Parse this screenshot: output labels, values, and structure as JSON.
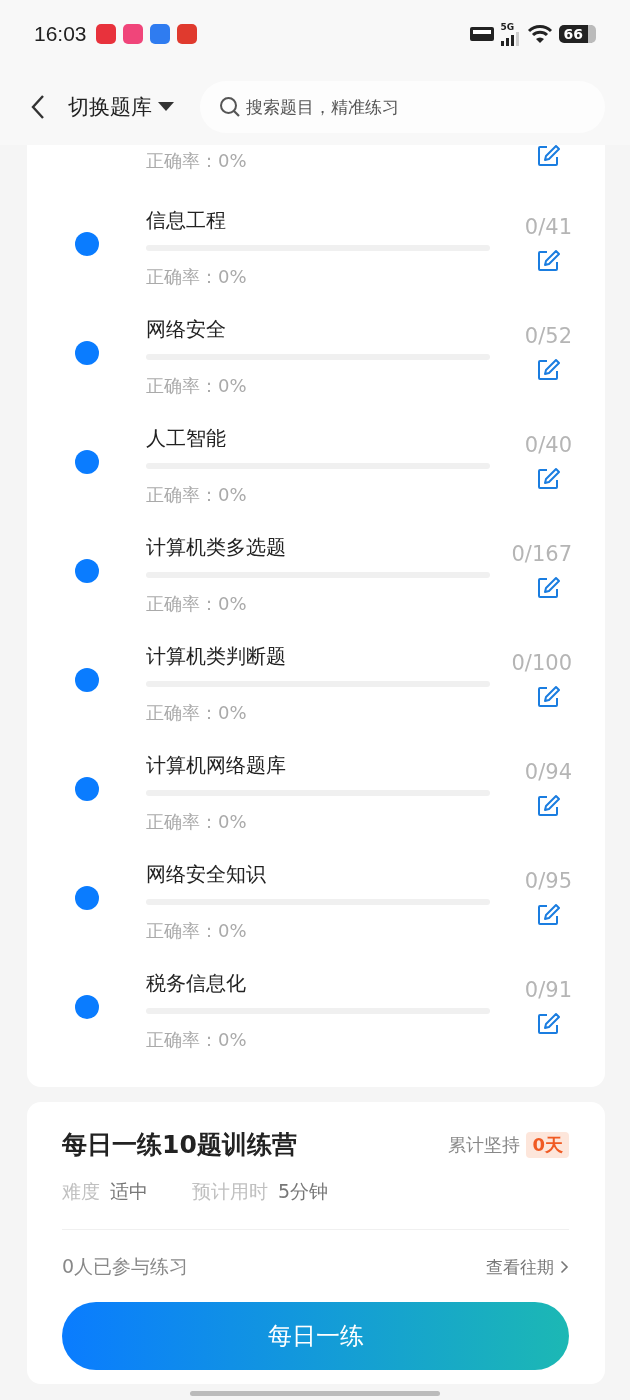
{
  "status_bar": {
    "time": "16:03",
    "network": "5G",
    "battery": "66"
  },
  "header": {
    "title": "切换题库",
    "search": {
      "placeholder": "搜索题目，精准练习"
    }
  },
  "banks": [
    {
      "kind": "clipped",
      "accuracy": "正确率：0%"
    },
    {
      "kind": "full",
      "name": "信息工程",
      "level": 0,
      "count": "0/41",
      "accuracy": "正确率：0%",
      "color": "#0a7cff"
    },
    {
      "kind": "full",
      "name": "网络安全",
      "level": 0,
      "count": "0/52",
      "accuracy": "正确率：0%",
      "color": "#0a7cff"
    },
    {
      "kind": "full",
      "name": "人工智能",
      "level": 0,
      "count": "0/40",
      "accuracy": "正确率：0%",
      "color": "#0a7cff"
    },
    {
      "kind": "full",
      "name": "计算机类多选题",
      "level": 0,
      "count": "0/167",
      "accuracy": "正确率：0%",
      "color": "#0a7cff"
    },
    {
      "kind": "full",
      "name": "计算机类判断题",
      "level": 0,
      "count": "0/100",
      "accuracy": "正确率：0%",
      "color": "#0a7cff"
    },
    {
      "kind": "full",
      "name": "计算机网络题库",
      "level": 0,
      "count": "0/94",
      "accuracy": "正确率：0%",
      "color": "#0a7cff"
    },
    {
      "kind": "full",
      "name": "网络安全知识",
      "level": 0,
      "count": "0/95",
      "accuracy": "正确率：0%",
      "color": "#0a7cff"
    },
    {
      "kind": "full",
      "name": "税务信息化",
      "level": 0,
      "count": "0/91",
      "accuracy": "正确率：0%",
      "color": "#0a7cff"
    }
  ],
  "camp": {
    "title": "每日一练10题训练营",
    "streak_label": "累计坚持",
    "streak": "0天",
    "stats": [
      {
        "label": "难度",
        "value": "适中"
      },
      {
        "label": "预计用时",
        "value": "5分钟"
      }
    ],
    "participants": "0人已参与练习",
    "history_link": "查看往期",
    "button": "每日一练"
  }
}
